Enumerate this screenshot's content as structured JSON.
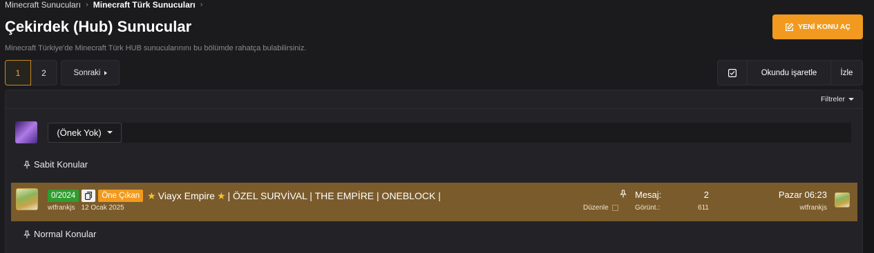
{
  "breadcrumb": {
    "items": [
      "Minecraft Sunucuları",
      "Minecraft Türk Sunucuları"
    ]
  },
  "page": {
    "title": "Çekirdek (Hub) Sunucular",
    "description": "Minecraft Türkiye'de Minecraft Türk HUB sunucularınını bu bölümde rahatça bulabilirsiniz."
  },
  "header": {
    "new_topic_label": "YENİ KONU AÇ"
  },
  "pagination": {
    "pages": [
      "1",
      "2"
    ],
    "current": "1",
    "next_label": "Sonraki"
  },
  "actions": {
    "mark_read_label": "Okundu işaretle",
    "watch_label": "İzle"
  },
  "filters": {
    "label": "Filtreler"
  },
  "compose": {
    "prefix_label": "(Önek Yok)",
    "title_placeholder": ""
  },
  "sections": {
    "sticky": "Sabit Konular",
    "normal": "Normal Konular"
  },
  "thread": {
    "prefix_count": "0/2024",
    "featured_label": "Öne Çıkan",
    "title": "Viayx Empire",
    "title_rest": "| ÖZEL SURVİVAL | THE EMPİRE | ONEBLOCK |",
    "author": "wtfrankjs",
    "date": "12 Ocak 2025",
    "edit_label": "Düzenle",
    "replies_label": "Mesaj:",
    "replies": "2",
    "views_label": "Görünt.:",
    "views": "611",
    "last_post_date": "Pazar 06:23",
    "last_post_user": "wtfrankjs"
  },
  "colors": {
    "accent": "#f19a1f",
    "featured_row": "#7a5b2c",
    "prefix_green": "#2f9d2f"
  }
}
